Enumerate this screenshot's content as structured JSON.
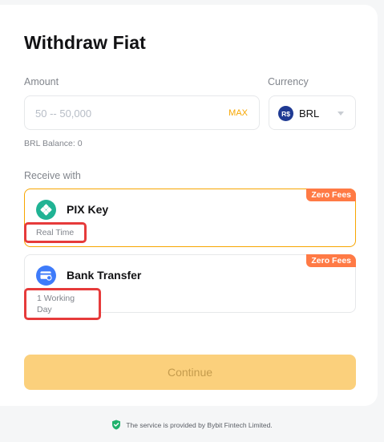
{
  "title": "Withdraw Fiat",
  "amount": {
    "label": "Amount",
    "placeholder": "50 -- 50,000",
    "value": "",
    "max_label": "MAX"
  },
  "currency": {
    "label": "Currency",
    "symbol": "R$",
    "selected": "BRL"
  },
  "balance": "BRL Balance: 0",
  "receive_label": "Receive with",
  "methods": [
    {
      "name": "PIX Key",
      "badge": "Zero Fees",
      "tag": "Real Time",
      "icon": "pix-icon",
      "selected": true
    },
    {
      "name": "Bank Transfer",
      "badge": "Zero Fees",
      "tag": "1 Working Day",
      "icon": "bank-card-icon",
      "selected": false
    }
  ],
  "continue_label": "Continue",
  "footer_text": "The service is provided by Bybit Fintech Limited.",
  "colors": {
    "accent": "#f7a600",
    "continue_bg": "#fbd07c",
    "badge": "#ff7a45",
    "highlight": "#e63b3b",
    "pix": "#20b394",
    "bank": "#3e7bfa",
    "shield": "#20b26c"
  }
}
